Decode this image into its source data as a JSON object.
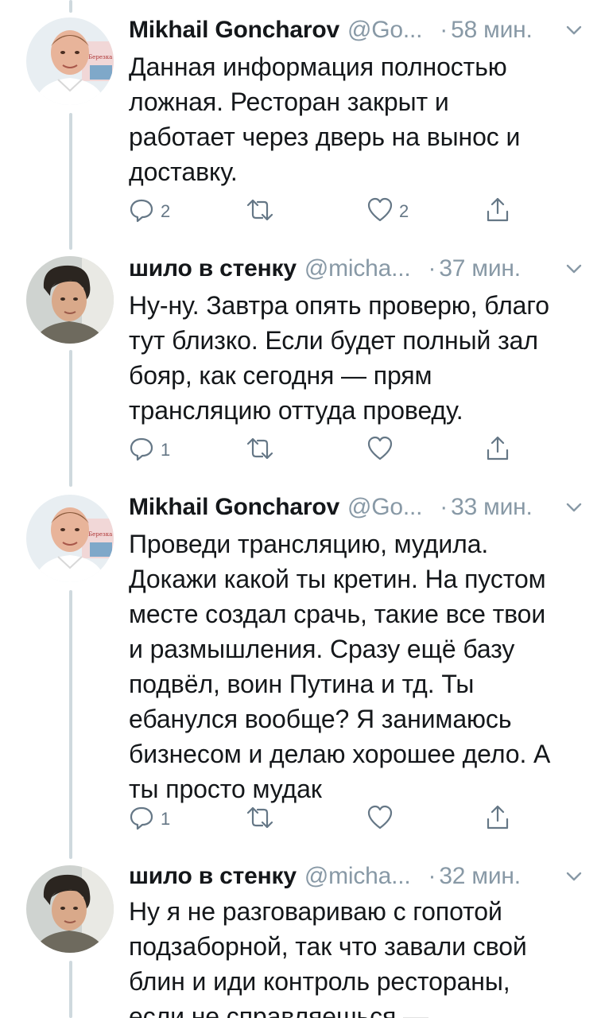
{
  "tweets": [
    {
      "name": "Mikhail Goncharov",
      "handle": "@Go...",
      "separator": "·",
      "time": "58 мин.",
      "text": "Данная информация полностью\nложная. Ресторан закрыт и\nработает через дверь на вынос и\nдоставку.",
      "reply_count": "2",
      "retweet_count": "",
      "like_count": "2",
      "avatar_icon": "avatar-mikhail"
    },
    {
      "name": "шило в стенку",
      "handle": "@micha...",
      "separator": "·",
      "time": "37 мин.",
      "text": "Ну-ну. Завтра опять проверю, благо\nтут близко. Если будет полный зал\nбояр, как сегодня — прям\nтрансляцию оттуда проведу.",
      "reply_count": "1",
      "retweet_count": "",
      "like_count": "",
      "avatar_icon": "avatar-shilo"
    },
    {
      "name": "Mikhail Goncharov",
      "handle": "@Go...",
      "separator": "·",
      "time": "33 мин.",
      "text": "Проведи трансляцию, мудила.\nДокажи какой ты кретин. На пустом\nместе создал срачь, такие все твои\nи размышления. Сразу ещё базу\nподвёл, воин Путина и тд. Ты\nебанулся вообще? Я занимаюсь\nбизнесом и делаю хорошее дело. А\nты просто мудак",
      "reply_count": "1",
      "retweet_count": "",
      "like_count": "",
      "avatar_icon": "avatar-mikhail"
    },
    {
      "name": "шило в стенку",
      "handle": "@micha...",
      "separator": "·",
      "time": "32 мин.",
      "text": "Ну я не разговариваю с гопотой\nподзаборной, так что завали свой\nблин и иди контроль рестораны,\nесли не справляешься —",
      "reply_count": "",
      "retweet_count": "",
      "like_count": "",
      "avatar_icon": "avatar-shilo"
    }
  ],
  "icons": {
    "reply": "reply-icon",
    "retweet": "retweet-icon",
    "like": "heart-icon",
    "share": "share-icon",
    "menu": "chevron-down-icon"
  },
  "colors": {
    "text": "#14171a",
    "secondary": "#8899a6",
    "icon": "#657786",
    "thread_line": "#cfd9de"
  }
}
